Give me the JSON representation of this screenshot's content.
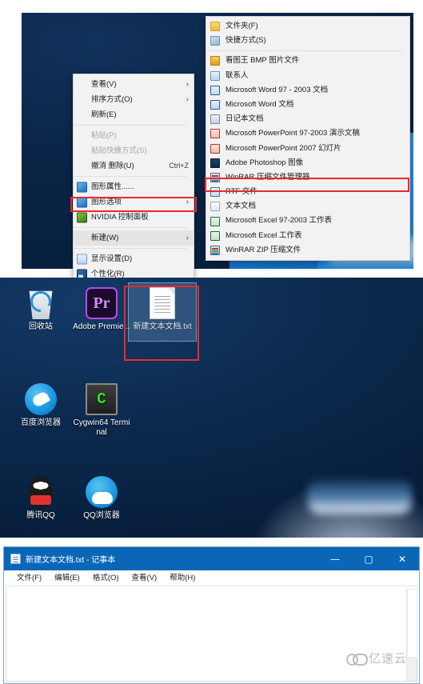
{
  "panel1": {
    "context_menu": {
      "items": [
        {
          "label": "查看(V)",
          "arrow": "›",
          "icon": "none",
          "disabled": false
        },
        {
          "label": "排序方式(O)",
          "arrow": "›",
          "icon": "none",
          "disabled": false
        },
        {
          "label": "刷新(E)",
          "arrow": "",
          "icon": "none",
          "disabled": false
        },
        {
          "separator": true
        },
        {
          "label": "粘贴(P)",
          "arrow": "",
          "icon": "none",
          "disabled": true
        },
        {
          "label": "粘贴快捷方式(S)",
          "arrow": "",
          "icon": "none",
          "disabled": true
        },
        {
          "label": "撤消 删除(U)",
          "accel": "Ctrl+Z",
          "arrow": "",
          "icon": "none",
          "disabled": false
        },
        {
          "separator": true
        },
        {
          "label": "图形属性......",
          "arrow": "",
          "icon": "graphics-properties",
          "disabled": false
        },
        {
          "label": "图形选项",
          "arrow": "›",
          "icon": "graphics-options",
          "disabled": false
        },
        {
          "label": "NVIDIA 控制面板",
          "arrow": "",
          "icon": "nvidia",
          "disabled": false
        },
        {
          "separator": true
        },
        {
          "label": "新建(W)",
          "arrow": "›",
          "icon": "none",
          "disabled": false,
          "highlighted": true
        },
        {
          "separator": true
        },
        {
          "label": "显示设置(D)",
          "arrow": "",
          "icon": "display-settings",
          "disabled": false
        },
        {
          "label": "个性化(R)",
          "arrow": "",
          "icon": "personalize",
          "disabled": false
        }
      ]
    },
    "submenu": {
      "items": [
        {
          "label": "文件夹(F)",
          "icon": "folder"
        },
        {
          "label": "快捷方式(S)",
          "icon": "shortcut"
        },
        {
          "separator": true
        },
        {
          "label": "看图王 BMP 图片文件",
          "icon": "bmp"
        },
        {
          "label": "联系人",
          "icon": "contact"
        },
        {
          "label": "Microsoft Word 97 - 2003 文档",
          "icon": "word"
        },
        {
          "label": "Microsoft Word 文档",
          "icon": "word"
        },
        {
          "label": "日记本文档",
          "icon": "journal"
        },
        {
          "label": "Microsoft PowerPoint 97-2003 演示文稿",
          "icon": "ppt"
        },
        {
          "label": "Microsoft PowerPoint 2007 幻灯片",
          "icon": "ppt"
        },
        {
          "label": "Adobe Photoshop 图像",
          "icon": "photoshop"
        },
        {
          "label": "WinRAR 压缩文件管理器",
          "icon": "winrar"
        },
        {
          "label": "RTF 文件",
          "icon": "rtf"
        },
        {
          "label": "文本文档",
          "icon": "textfile",
          "highlighted": true
        },
        {
          "label": "Microsoft Excel 97-2003 工作表",
          "icon": "excel"
        },
        {
          "label": "Microsoft Excel 工作表",
          "icon": "excel"
        },
        {
          "label": "WinRAR ZIP 压缩文件",
          "icon": "winrarzip"
        }
      ]
    }
  },
  "panel2": {
    "icons": [
      {
        "label": "回收站",
        "glyph": "recycle-bin-icon",
        "selected": false
      },
      {
        "label": "Adobe Premie...",
        "glyph": "adobe-premiere-icon",
        "selected": false
      },
      {
        "label": "新建文本文档.txt",
        "glyph": "text-file-icon",
        "selected": true
      },
      {
        "label": "百度浏览器",
        "glyph": "baidu-browser-icon",
        "selected": false
      },
      {
        "label": "Cygwin64 Terminal",
        "glyph": "cygwin-terminal-icon",
        "selected": false
      },
      {
        "label": "腾讯QQ",
        "glyph": "tencent-qq-icon",
        "selected": false
      },
      {
        "label": "QQ浏览器",
        "glyph": "qq-browser-icon",
        "selected": false
      }
    ]
  },
  "panel3": {
    "title": "新建文本文档.txt - 记事本",
    "controls": {
      "minimize": "—",
      "maximize": "▢",
      "close": "✕"
    },
    "menus": [
      "文件(F)",
      "编辑(E)",
      "格式(O)",
      "查看(V)",
      "帮助(H)"
    ],
    "content": "",
    "watermark": "亿速云"
  },
  "colors": {
    "desktop": "#0a2547",
    "titlebar": "#0a67b8",
    "highlight_box": "#e8292f",
    "menu_bg": "#f2f2f2"
  }
}
